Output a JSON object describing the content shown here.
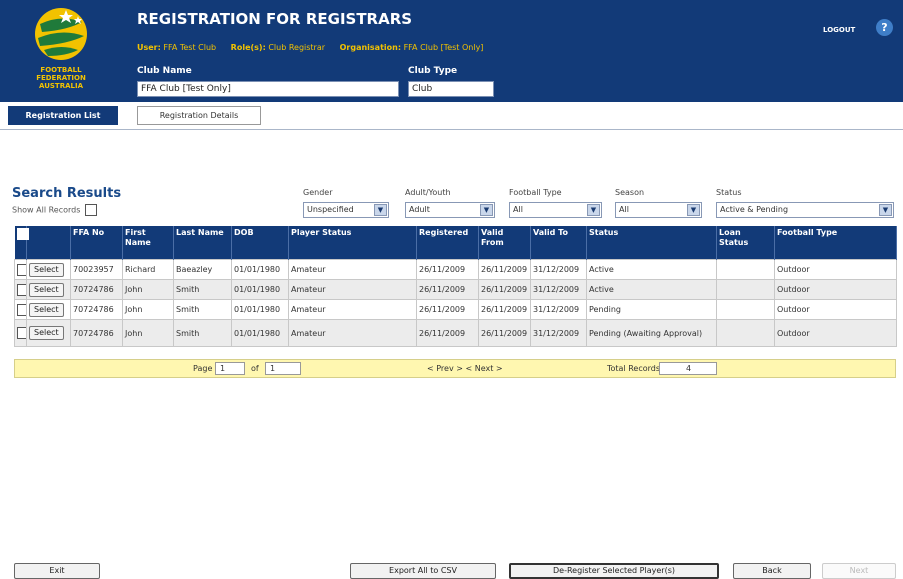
{
  "header": {
    "title": "REGISTRATION FOR REGISTRARS",
    "logo_text": "FOOTBALL FEDERATION AUSTRALIA",
    "user_label": "User:",
    "user_value": "FFA Test Club",
    "roles_label": "Role(s):",
    "roles_value": "Club Registrar",
    "org_label": "Organisation:",
    "org_value": "FFA Club [Test Only]",
    "logout": "LOGOUT",
    "help": "?"
  },
  "club": {
    "name_label": "Club Name",
    "name_value": "FFA Club [Test Only]",
    "type_label": "Club Type",
    "type_value": "Club"
  },
  "tabs": [
    {
      "label": "Registration List"
    },
    {
      "label": "Registration Details"
    }
  ],
  "search": {
    "title": "Search Results",
    "show_all": "Show All Records"
  },
  "filters": {
    "gender": {
      "label": "Gender",
      "value": "Unspecified"
    },
    "adult_youth": {
      "label": "Adult/Youth",
      "value": "Adult"
    },
    "football_type": {
      "label": "Football Type",
      "value": "All"
    },
    "season": {
      "label": "Season",
      "value": "All"
    },
    "status": {
      "label": "Status",
      "value": "Active & Pending"
    }
  },
  "table": {
    "headers": [
      "FFA No",
      "First Name",
      "Last Name",
      "DOB",
      "Player Status",
      "Registered",
      "Valid From",
      "Valid To",
      "Status",
      "Loan Status",
      "Football Type"
    ],
    "select_label": "Select",
    "rows": [
      [
        "70023957",
        "Richard",
        "Baeazley",
        "01/01/1980",
        "Amateur",
        "26/11/2009",
        "26/11/2009",
        "31/12/2009",
        "Active",
        "",
        "Outdoor"
      ],
      [
        "70724786",
        "John",
        "Smith",
        "01/01/1980",
        "Amateur",
        "26/11/2009",
        "26/11/2009",
        "31/12/2009",
        "Active",
        "",
        "Outdoor"
      ],
      [
        "70724786",
        "John",
        "Smith",
        "01/01/1980",
        "Amateur",
        "26/11/2009",
        "26/11/2009",
        "31/12/2009",
        "Pending",
        "",
        "Outdoor"
      ],
      [
        "70724786",
        "John",
        "Smith",
        "01/01/1980",
        "Amateur",
        "26/11/2009",
        "26/11/2009",
        "31/12/2009",
        "Pending (Awaiting Approval)",
        "",
        "Outdoor"
      ]
    ]
  },
  "pager": {
    "page_label": "Page",
    "page": "1",
    "of_label": "of",
    "of": "1",
    "nav": "< Prev > < Next >",
    "total_label": "Total Records",
    "total": "4"
  },
  "buttons": {
    "exit": "Exit",
    "export": "Export All to CSV",
    "deregister": "De-Register Selected Player(s)",
    "back": "Back",
    "next": "Next"
  },
  "colors": {
    "header_bg": "#123a78",
    "accent_yellow": "#f2c200",
    "pager_bg": "#fff7b0"
  }
}
